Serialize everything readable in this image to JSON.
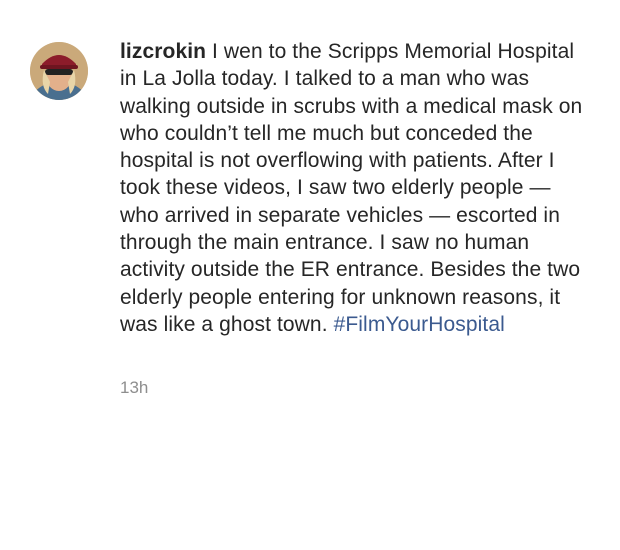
{
  "comment": {
    "username": "lizcrokin",
    "text": "I wen to the Scripps Memorial Hospital in La Jolla today. I talked to a man who was walking outside in scrubs with a medical mask on who couldn’t tell me much but conceded the hospital is not overflowing with patients. After I took these videos, I saw two elderly people — who arrived in separate vehicles — escorted in through the main entrance. I saw no human activity outside the ER entrance. Besides the two elderly people entering for unknown reasons, it was like a ghost town.",
    "hashtag": "#FilmYourHospital",
    "timestamp": "13h"
  },
  "colors": {
    "text": "#262626",
    "hashtag": "#3b5a8f",
    "timestamp": "#8e8e8e"
  }
}
